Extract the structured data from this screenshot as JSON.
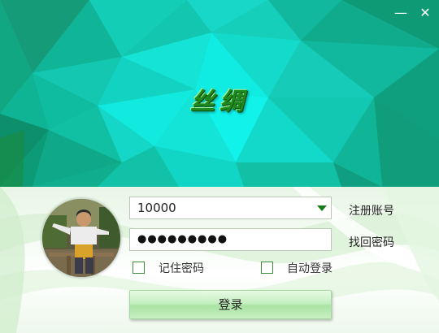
{
  "window": {
    "title": "丝绸",
    "minimize_glyph": "—",
    "close_glyph": "✕"
  },
  "colors": {
    "banner_teal": "#12c9b2",
    "banner_bright": "#12ede2",
    "banner_dark": "#0f8f6a",
    "title_green": "#1f8a1f",
    "accent_green": "#1a7a1a"
  },
  "login": {
    "avatar_icon": "user-avatar-photo",
    "account_value": "10000",
    "password_value": "●●●●●●●●●",
    "register_link": "注册账号",
    "recover_link": "找回密码",
    "remember_label": "记住密码",
    "auto_login_label": "自动登录",
    "remember_checked": false,
    "auto_login_checked": false,
    "login_button": "登录"
  }
}
